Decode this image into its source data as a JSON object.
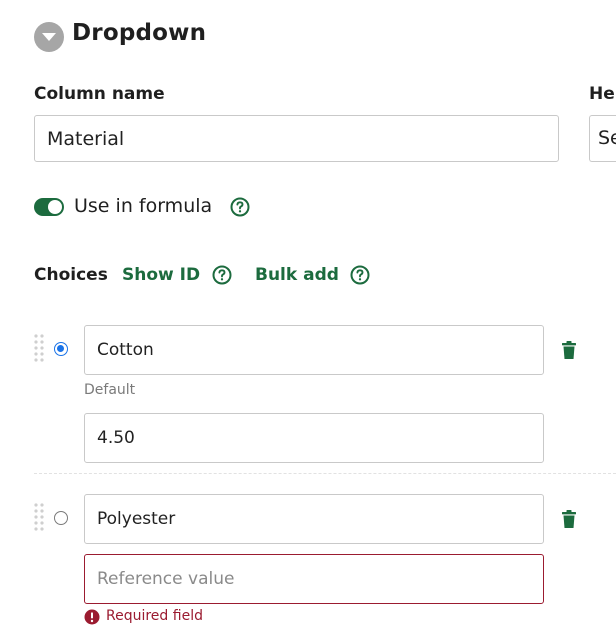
{
  "header": {
    "title": "Dropdown",
    "icon": "chevron-down-circle-icon"
  },
  "column_name": {
    "label": "Column name",
    "value": "Material"
  },
  "help_text": {
    "label_partial": "Hel",
    "value_partial": "Se"
  },
  "use_in_formula": {
    "label": "Use in formula",
    "checked": true
  },
  "choices": {
    "label": "Choices",
    "show_id_label": "Show ID",
    "bulk_add_label": "Bulk add",
    "items": [
      {
        "name": "Cotton",
        "default": true,
        "default_label": "Default",
        "reference_value": "4.50",
        "reference_placeholder": ""
      },
      {
        "name": "Polyester",
        "default": false,
        "reference_value": "",
        "reference_placeholder": "Reference value",
        "error": "Required field"
      }
    ]
  },
  "colors": {
    "accent_green": "#1c6b3e",
    "radio_blue": "#1a73e8",
    "error_red": "#9b1b30",
    "header_icon_gray": "#a6a6a6"
  }
}
